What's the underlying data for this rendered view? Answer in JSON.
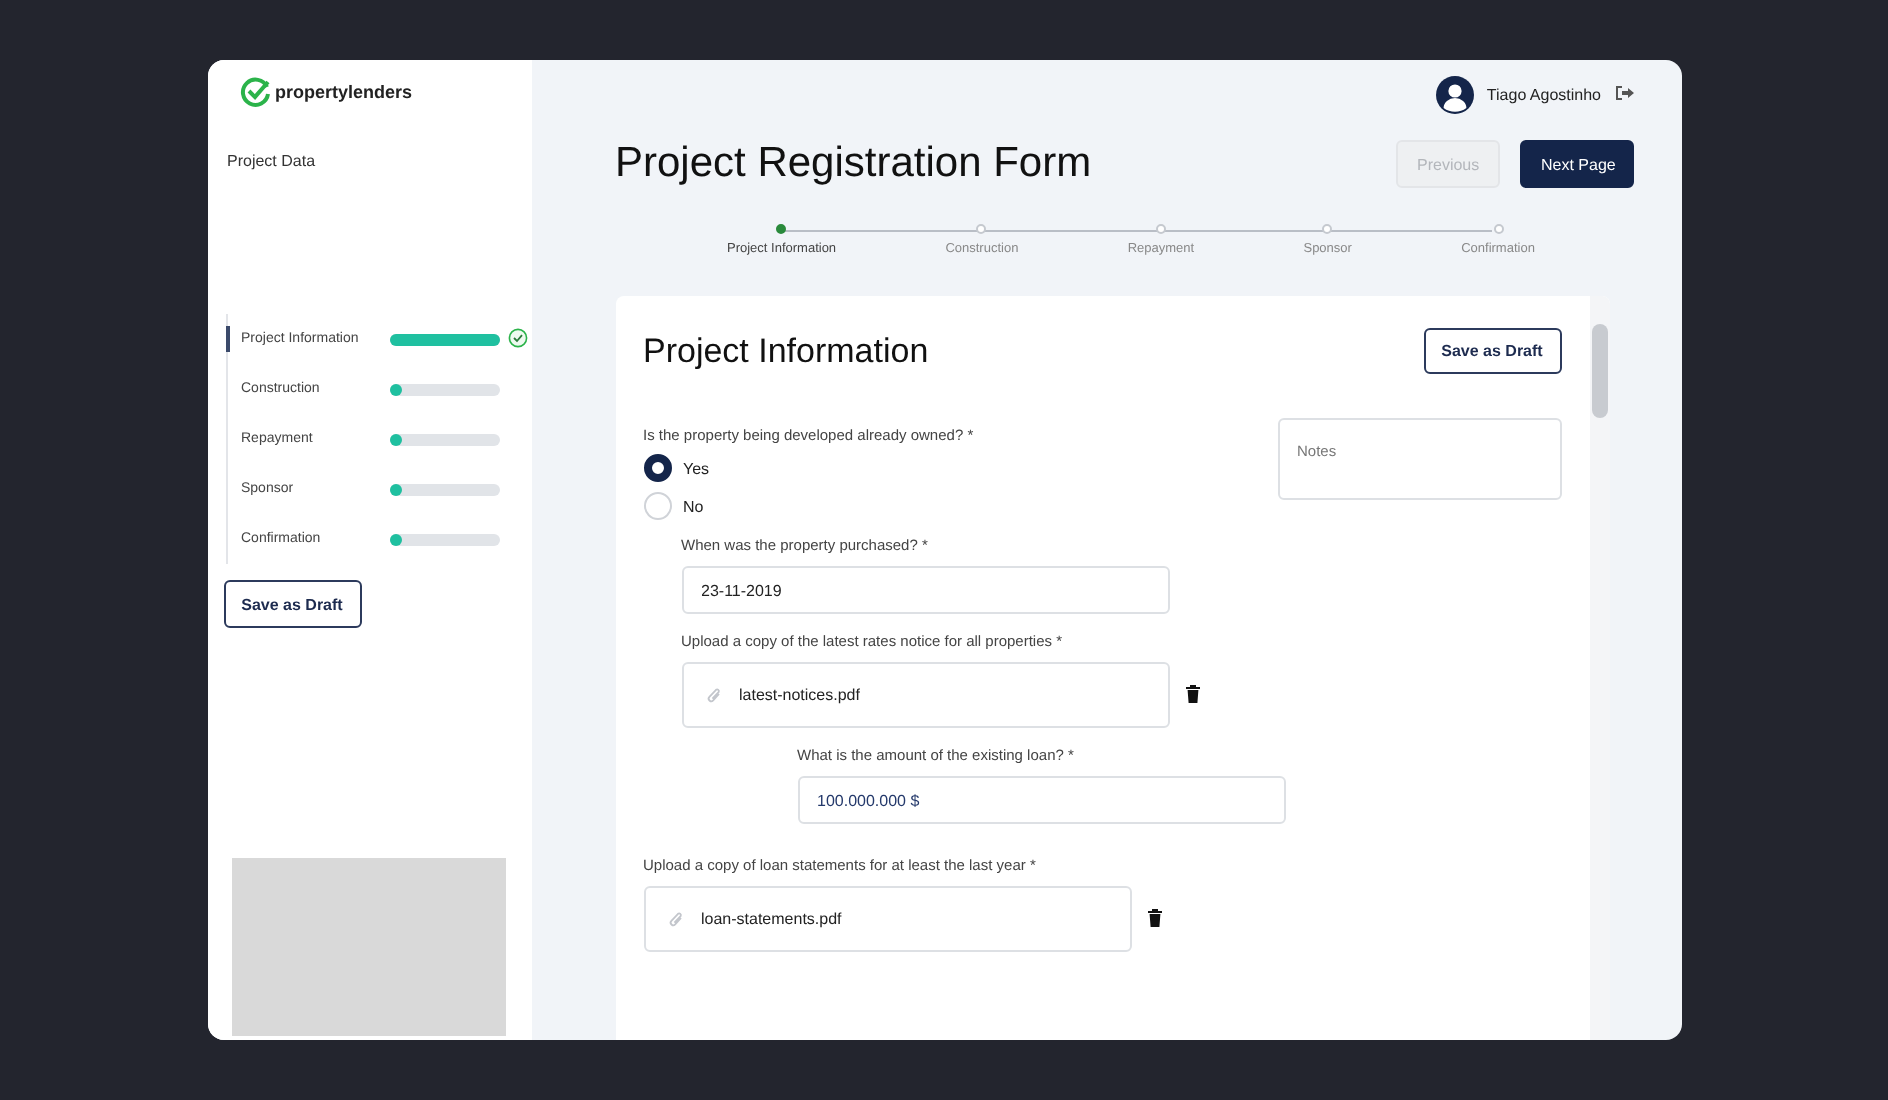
{
  "logo": {
    "text": "propertylenders"
  },
  "sidebar": {
    "title": "Project Data",
    "steps": [
      {
        "label": "Project Information",
        "selected": true,
        "level": 1,
        "completed": true
      },
      {
        "label": "Construction",
        "selected": false,
        "level": 0.06,
        "completed": false
      },
      {
        "label": "Repayment",
        "selected": false,
        "level": 0.06,
        "completed": false
      },
      {
        "label": "Sponsor",
        "selected": false,
        "level": 0.06,
        "completed": false
      },
      {
        "label": "Confirmation",
        "selected": false,
        "level": 0.06,
        "completed": false
      }
    ],
    "save_button": "Save as Draft"
  },
  "user": {
    "name": "Tiago Agostinho"
  },
  "page_title": "Project Registration Form",
  "nav_buttons": [
    {
      "label": "Previous",
      "disabled": true
    },
    {
      "label": "Next Page",
      "disabled": false
    }
  ],
  "stepper": [
    {
      "label": "Project Information",
      "selected": true
    },
    {
      "label": "Construction",
      "selected": false
    },
    {
      "label": "Repayment",
      "selected": false
    },
    {
      "label": "Sponsor",
      "selected": false
    },
    {
      "label": "Confirmation",
      "selected": false
    }
  ],
  "card": {
    "title": "Project Information",
    "save_button": "Save as Draft",
    "notes": {
      "placeholder": "Notes"
    },
    "question": "Is the property being developed already owned? *",
    "options": [
      {
        "label": "Yes",
        "selected": true
      },
      {
        "label": "No",
        "selected": false
      }
    ],
    "fields": [
      {
        "kind": "text",
        "label": "When was the property purchased? *",
        "value": "23-11-2019"
      },
      {
        "kind": "file",
        "label": "Upload a copy of the latest rates notice for all properties *",
        "value": "latest-notices.pdf"
      },
      {
        "kind": "text",
        "label": "What is the amount of the existing loan? *",
        "value": "100.000.000 $"
      },
      {
        "kind": "file",
        "label": "Upload a copy of loan statements for at least the last year *",
        "value": "loan-statements.pdf"
      }
    ]
  }
}
